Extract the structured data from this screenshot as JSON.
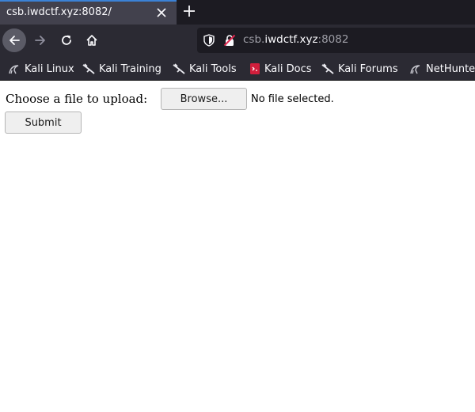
{
  "browser": {
    "tab": {
      "title": "csb.iwdctf.xyz:8082/"
    },
    "urlbar": {
      "host_prefix": "csb.",
      "host_domain": "iwdctf.xyz",
      "port": ":8082"
    },
    "bookmarks": [
      {
        "label": "Kali Linux",
        "icon": "kali-dragon-icon"
      },
      {
        "label": "Kali Training",
        "icon": "kali-icon"
      },
      {
        "label": "Kali Tools",
        "icon": "kali-icon"
      },
      {
        "label": "Kali Docs",
        "icon": "kali-docs-icon"
      },
      {
        "label": "Kali Forums",
        "icon": "kali-icon"
      },
      {
        "label": "NetHunter",
        "icon": "kali-dragon-icon"
      }
    ],
    "colors": {
      "tab_accent": "#3b82d6",
      "toolbar_bg": "#2b2a33",
      "tabstrip_bg": "#1c1b22"
    }
  },
  "page": {
    "form_label": "Choose a file to upload:",
    "browse_button": "Browse...",
    "file_status": "No file selected.",
    "submit_button": "Submit"
  }
}
